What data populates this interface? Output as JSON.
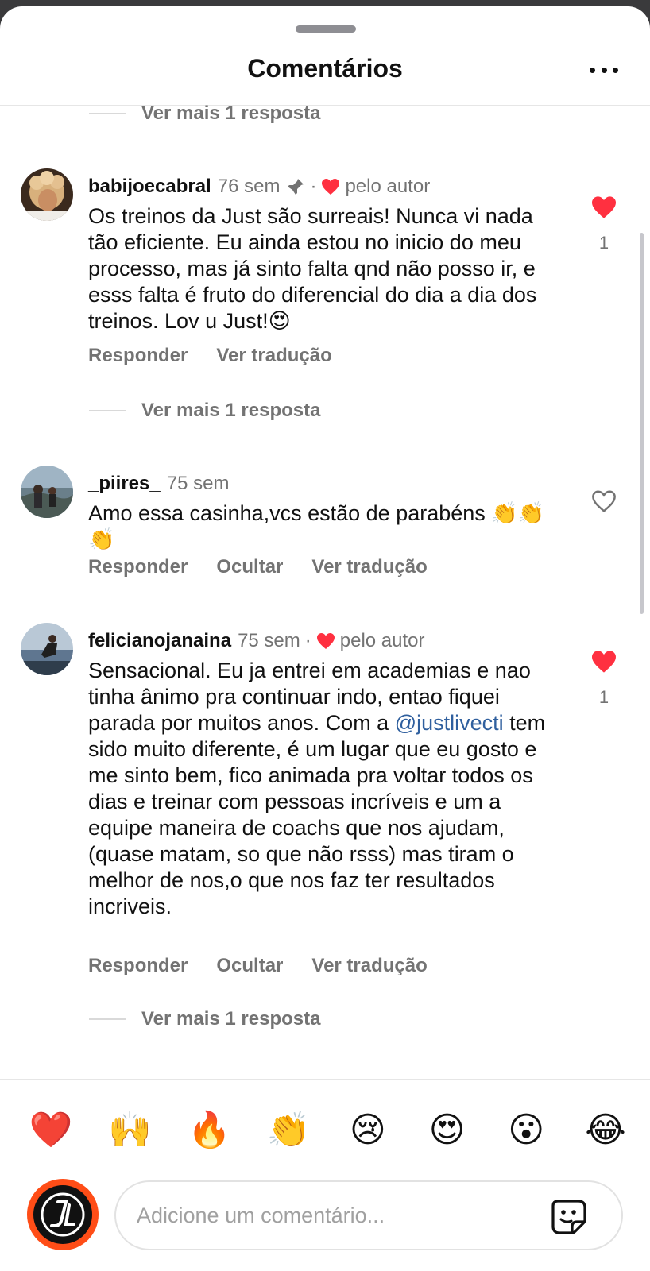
{
  "header": {
    "title": "Comentários",
    "more_icon": "more-dots-icon"
  },
  "view_more_label": "Ver mais 1 resposta",
  "comments": [
    {
      "username": "babijoecabral",
      "time": "76 sem",
      "pinned": true,
      "liked_by_author": "pelo autor",
      "text": "Os treinos da Just são surreais! Nunca vi nada tão eficiente. Eu ainda estou no inicio do meu processo, mas já sinto falta qnd não posso ir, e esss falta é fruto do diferencial do dia a dia dos treinos. Lov u Just!😍",
      "actions": [
        "Responder",
        "Ver tradução"
      ],
      "liked": true,
      "like_count": "1"
    },
    {
      "username": "_piires_",
      "time": "75 sem",
      "text": "Amo essa casinha,vcs estão de parabéns 👏👏👏",
      "actions": [
        "Responder",
        "Ocultar",
        "Ver tradução"
      ],
      "liked": false
    },
    {
      "username": "felicianojanaina",
      "time": "75 sem",
      "liked_by_author": "pelo autor",
      "text_before": "Sensacional.  Eu ja entrei em academias e nao tinha ânimo pra continuar indo, entao fiquei parada por muitos anos. Com a ",
      "mention": "@justlivecti",
      "text_after": " tem sido muito diferente, é um lugar que eu gosto e me sinto bem, fico animada pra voltar todos os dias e treinar com pessoas incríveis e um a equipe maneira de coachs que nos ajudam, (quase matam, so que não rsss) mas tiram o melhor de nos,o que nos faz ter resultados incriveis.",
      "actions": [
        "Responder",
        "Ocultar",
        "Ver tradução"
      ],
      "liked": true,
      "like_count": "1"
    }
  ],
  "emoji_bar": [
    "❤️",
    "🙌",
    "🔥",
    "👏",
    "😢",
    "😍",
    "😮",
    "😂"
  ],
  "composer": {
    "placeholder": "Adicione um comentário...",
    "sticker_icon": "sticker-icon"
  },
  "colors": {
    "like_red": "#ff3040",
    "muted": "#737373",
    "mention": "#2f5f9e",
    "brand_orange": "#ff4d17"
  }
}
